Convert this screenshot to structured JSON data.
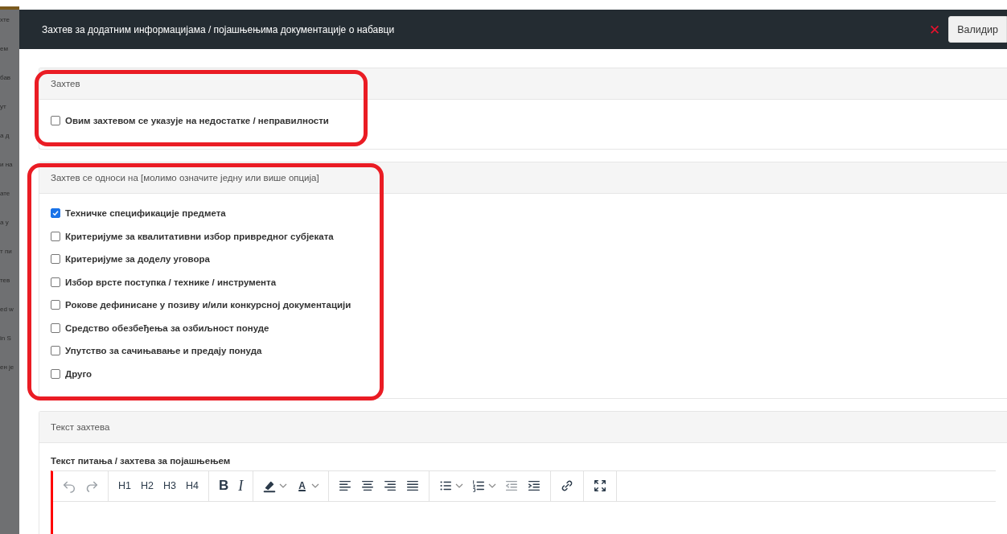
{
  "background_page": {
    "fragments": [
      "хте",
      "ем",
      "бав",
      "ут",
      "а д",
      "и на",
      "ате",
      "а у",
      "т пи",
      "тев",
      "ed w",
      "in S",
      "ен је"
    ]
  },
  "dialog": {
    "title": "Захтев за додатним информацијама / појашњењима документације о набавци",
    "close_icon": "✕",
    "validate_button": "Валидир"
  },
  "request_section": {
    "title": "Захтев",
    "highlighted": true,
    "options": [
      {
        "label": "Овим захтевом се указује на недостатке / неправилности",
        "checked": false
      }
    ]
  },
  "subject_section": {
    "title": "Захтев се односи на [молимо означите једну или више опција]",
    "highlighted": true,
    "options": [
      {
        "label": "Техничке спецификације предмета",
        "checked": true
      },
      {
        "label": "Критеријуме за квалитативни избор привредног субјеката",
        "checked": false
      },
      {
        "label": "Критеријуме за доделу уговора",
        "checked": false
      },
      {
        "label": "Избор врсте поступка / технике / инструмента",
        "checked": false
      },
      {
        "label": "Рокове дефинисане у позиву и/или конкурсној документацији",
        "checked": false
      },
      {
        "label": "Средство обезбеђења за озбиљност понуде",
        "checked": false
      },
      {
        "label": "Упутство за сачињавање и предају понуда",
        "checked": false
      },
      {
        "label": "Друго",
        "checked": false
      }
    ]
  },
  "text_section": {
    "title": "Текст захтева",
    "field_label": "Текст питања / захтева за појашњењем",
    "invalid": true,
    "toolbar": [
      [
        {
          "kind": "undo",
          "disabled": true
        },
        {
          "kind": "redo",
          "disabled": true
        }
      ],
      [
        {
          "kind": "text",
          "label": "H1",
          "disabled": false
        },
        {
          "kind": "text",
          "label": "H2",
          "disabled": false
        },
        {
          "kind": "text",
          "label": "H3",
          "disabled": false
        },
        {
          "kind": "text",
          "label": "H4",
          "disabled": false
        }
      ],
      [
        {
          "kind": "bold",
          "label": "B",
          "disabled": false
        },
        {
          "kind": "italic",
          "label": "I",
          "disabled": false
        }
      ],
      [
        {
          "kind": "highlight",
          "disabled": false
        },
        {
          "kind": "font-color",
          "label": "A",
          "disabled": false
        }
      ],
      [
        {
          "kind": "align-left",
          "disabled": false
        },
        {
          "kind": "align-center",
          "disabled": false
        },
        {
          "kind": "align-right",
          "disabled": false
        },
        {
          "kind": "justify",
          "disabled": false
        }
      ],
      [
        {
          "kind": "bullet-list",
          "disabled": false
        },
        {
          "kind": "numbered-list",
          "disabled": false
        },
        {
          "kind": "outdent",
          "disabled": true
        },
        {
          "kind": "indent",
          "disabled": false
        }
      ],
      [
        {
          "kind": "link",
          "disabled": false
        }
      ],
      [
        {
          "kind": "fullscreen",
          "disabled": false
        }
      ]
    ]
  }
}
